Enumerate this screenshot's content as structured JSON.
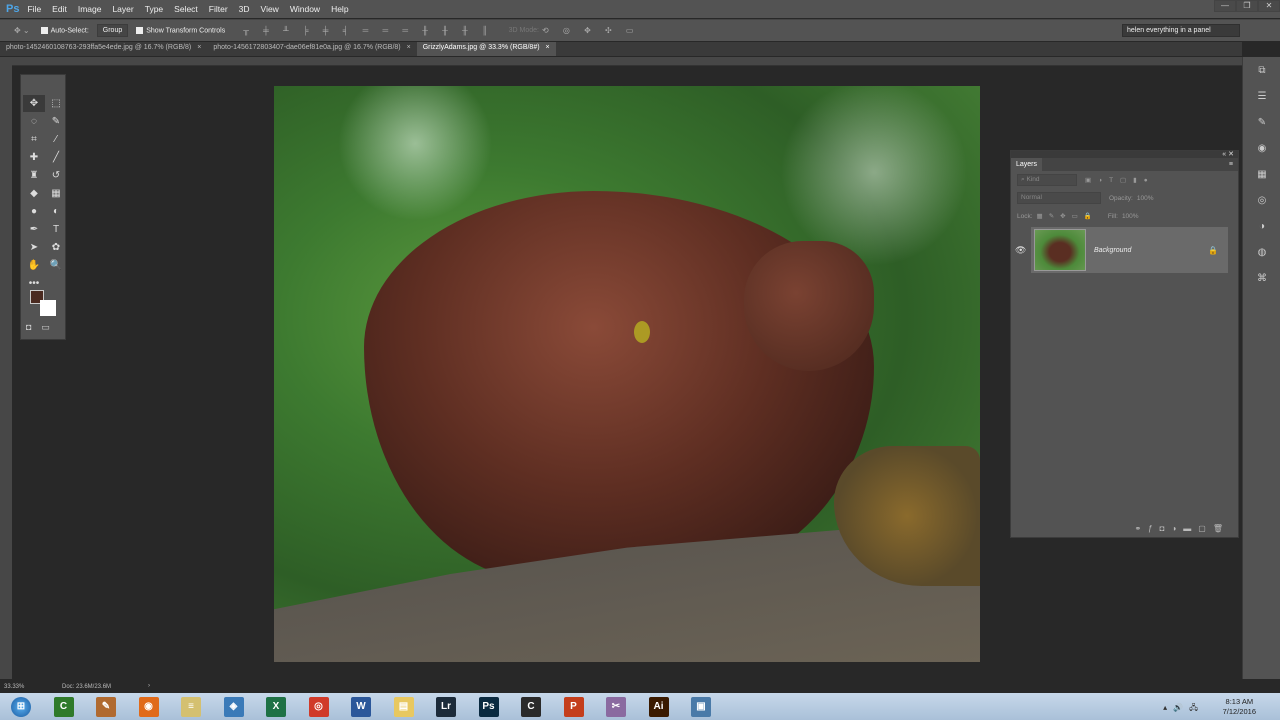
{
  "app": {
    "logo": "Ps",
    "menu": [
      "File",
      "Edit",
      "Image",
      "Layer",
      "Type",
      "Select",
      "Filter",
      "3D",
      "View",
      "Window",
      "Help"
    ]
  },
  "options": {
    "auto_select": "Auto-Select:",
    "group": "Group",
    "show_transform": "Show Transform Controls",
    "mode3d": "3D Mode:",
    "workspace": "helen everything in a panel"
  },
  "tabs": [
    {
      "label": "photo-1452460108763-293ffa5e4ede.jpg @ 16.7% (RGB/8)",
      "active": false
    },
    {
      "label": "photo-1456172803407-dae06ef81e0a.jpg @ 16.7% (RGB/8)",
      "active": false
    },
    {
      "label": "GrizzlyAdams.jpg @ 33.3% (RGB/8#)",
      "active": true
    }
  ],
  "tools": [
    {
      "icon": "move-icon",
      "g": "✥"
    },
    {
      "icon": "marquee-icon",
      "g": "⬚"
    },
    {
      "icon": "lasso-icon",
      "g": "◌"
    },
    {
      "icon": "quick-select-icon",
      "g": "✎"
    },
    {
      "icon": "crop-icon",
      "g": "⌗"
    },
    {
      "icon": "eyedropper-icon",
      "g": "⁄"
    },
    {
      "icon": "healing-icon",
      "g": "✚"
    },
    {
      "icon": "brush-icon",
      "g": "╱"
    },
    {
      "icon": "clone-stamp-icon",
      "g": "♜"
    },
    {
      "icon": "history-brush-icon",
      "g": "↺"
    },
    {
      "icon": "eraser-icon",
      "g": "◆"
    },
    {
      "icon": "gradient-icon",
      "g": "▦"
    },
    {
      "icon": "blur-icon",
      "g": "●"
    },
    {
      "icon": "dodge-icon",
      "g": "◐"
    },
    {
      "icon": "pen-icon",
      "g": "✒"
    },
    {
      "icon": "type-icon",
      "g": "T"
    },
    {
      "icon": "path-select-icon",
      "g": "➤"
    },
    {
      "icon": "shape-icon",
      "g": "✿"
    },
    {
      "icon": "hand-icon",
      "g": "✋"
    },
    {
      "icon": "zoom-icon",
      "g": "🔍"
    },
    {
      "icon": "more-tools-icon",
      "g": "•••"
    }
  ],
  "layers": {
    "title": "Layers",
    "kind": "Kind",
    "blend": "Normal",
    "opacity_label": "Opacity:",
    "opacity": "100%",
    "lock_label": "Lock:",
    "fill_label": "Fill:",
    "fill": "100%",
    "items": [
      {
        "name": "Background",
        "locked": true,
        "visible": true
      }
    ]
  },
  "status": {
    "zoom": "33.33%",
    "doc": "Doc: 23.6M/23.6M"
  },
  "taskbar": {
    "apps": [
      {
        "name": "camtasia",
        "label": "C",
        "color": "#2f7a2a"
      },
      {
        "name": "paint",
        "label": "✎",
        "color": "#b06a30"
      },
      {
        "name": "firefox",
        "label": "◉",
        "color": "#e06a1a"
      },
      {
        "name": "notepad",
        "label": "≡",
        "color": "#d4c070"
      },
      {
        "name": "network",
        "label": "◈",
        "color": "#3a7ab8"
      },
      {
        "name": "excel",
        "label": "X",
        "color": "#1e7145"
      },
      {
        "name": "chrome",
        "label": "◎",
        "color": "#d03a2a"
      },
      {
        "name": "word",
        "label": "W",
        "color": "#2b579a"
      },
      {
        "name": "explorer",
        "label": "▤",
        "color": "#e8c860"
      },
      {
        "name": "lightroom",
        "label": "Lr",
        "color": "#1c2b3a"
      },
      {
        "name": "photoshop",
        "label": "Ps",
        "color": "#0a2a40"
      },
      {
        "name": "camtasia-recorder",
        "label": "C",
        "color": "#2a2a2a"
      },
      {
        "name": "powerpoint",
        "label": "P",
        "color": "#c43e1c"
      },
      {
        "name": "snipping",
        "label": "✂",
        "color": "#8a6aa0"
      },
      {
        "name": "illustrator",
        "label": "Ai",
        "color": "#3a1a00"
      },
      {
        "name": "photo-viewer",
        "label": "▣",
        "color": "#4a7aa8"
      }
    ],
    "time": "8:13 AM",
    "date": "7/12/2016"
  }
}
